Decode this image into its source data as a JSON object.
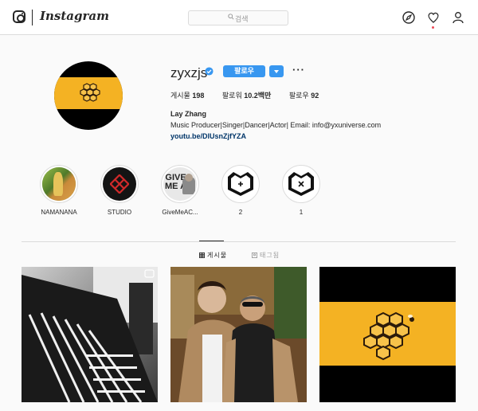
{
  "topbar": {
    "logo": "Instagram",
    "search_placeholder": "검색",
    "icons": [
      "explore-icon",
      "heart-icon",
      "profile-icon"
    ]
  },
  "profile": {
    "username": "zyxzjs",
    "verified": true,
    "follow_label": "팔로우",
    "stats": [
      {
        "label": "게시물",
        "value": "198"
      },
      {
        "label": "팔로워",
        "value": "10.2백만"
      },
      {
        "label": "팔로우",
        "value": "92"
      }
    ],
    "full_name": "Lay Zhang",
    "bio": "Music Producer|Singer|Dancer|Actor| Email: info@yxuniverse.com",
    "link": "youtu.be/DlUsnZjfYZA"
  },
  "highlights": [
    {
      "label": "NAMANANA"
    },
    {
      "label": "STUDIO"
    },
    {
      "label": "GiveMeAC..."
    },
    {
      "label": "2"
    },
    {
      "label": "1"
    }
  ],
  "tabs": [
    {
      "label": "게시물",
      "active": true
    },
    {
      "label": "태그됨",
      "active": false
    }
  ],
  "colors": {
    "accent": "#3897f0",
    "logo_yellow": "#f4b223",
    "link": "#003569"
  }
}
